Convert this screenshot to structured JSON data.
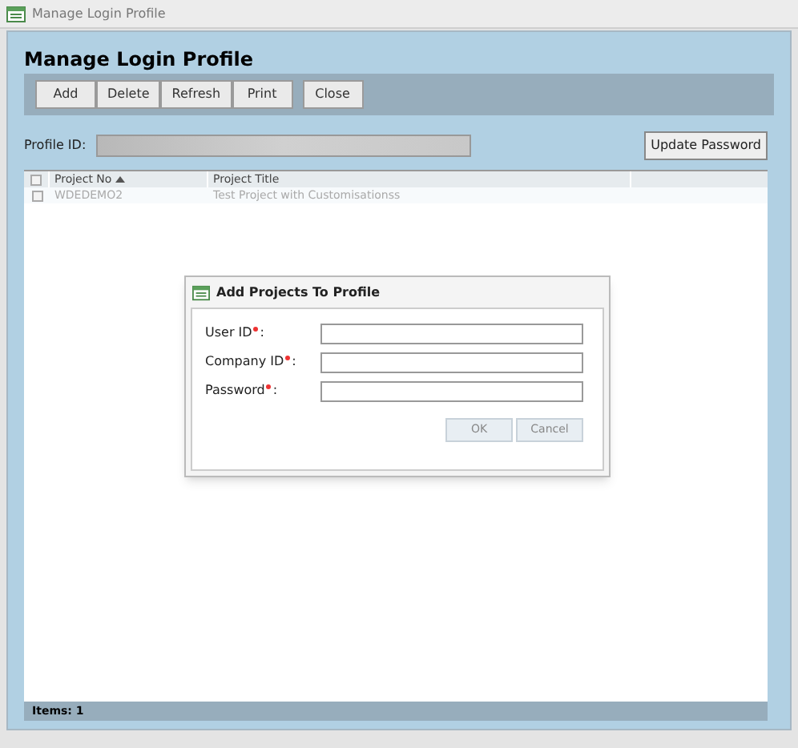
{
  "window": {
    "title": "Manage Login Profile"
  },
  "heading": "Manage Login Profile",
  "toolbar": [
    "Add",
    "Delete",
    "Refresh",
    "Print",
    "Close"
  ],
  "profile": {
    "label": "Profile ID:",
    "button": "Update Password"
  },
  "table": {
    "select_all_checked": false,
    "columns": [
      {
        "label": "Project No",
        "sorted": true
      },
      {
        "label": "Project Title",
        "sorted": false
      }
    ],
    "rows": [
      {
        "cells": [
          "WDEDEMO2",
          "Test Project with Customisationss"
        ],
        "checked": false
      }
    ]
  },
  "status_bar": "Items: 1",
  "dialog": {
    "title": "Add Projects To Profile",
    "fields": [
      {
        "label": "User ID",
        "required": true,
        "suffix": ":"
      },
      {
        "label": "Company ID",
        "required": true,
        "suffix": ":"
      },
      {
        "label": "Password",
        "required": true,
        "suffix": ":"
      }
    ],
    "buttons": [
      "OK",
      "Cancel"
    ]
  }
}
